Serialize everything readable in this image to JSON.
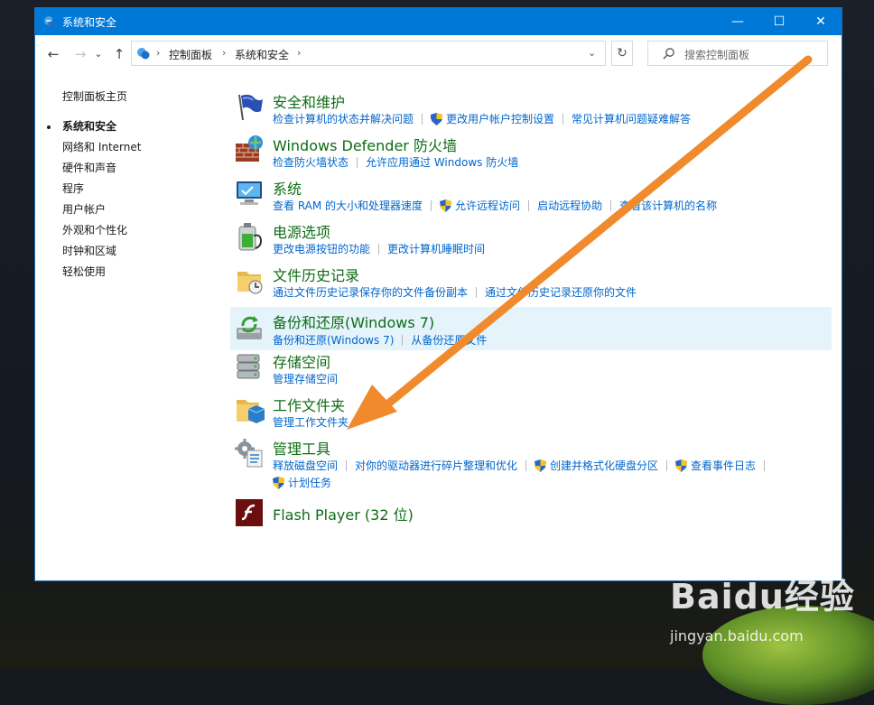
{
  "window": {
    "title": "系统和安全",
    "controls": {
      "minimize": "—",
      "maximize": "☐",
      "close": "✕"
    }
  },
  "nav": {
    "back": "←",
    "forward": "→",
    "recent": "⌄",
    "up": "↑",
    "breadcrumb": [
      "控制面板",
      "系统和安全"
    ],
    "dropdown": "⌄",
    "refresh": "↻",
    "search_placeholder": "搜索控制面板"
  },
  "sidebar": {
    "items": [
      {
        "label": "控制面板主页"
      },
      {
        "label": "系统和安全"
      },
      {
        "label": "网络和 Internet"
      },
      {
        "label": "硬件和声音"
      },
      {
        "label": "程序"
      },
      {
        "label": "用户帐户"
      },
      {
        "label": "外观和个性化"
      },
      {
        "label": "时钟和区域"
      },
      {
        "label": "轻松使用"
      }
    ]
  },
  "categories": [
    {
      "title": "安全和维护",
      "icon": "flag-icon",
      "links": [
        "检查计算机的状态并解决问题",
        "更改用户帐户控制设置",
        "常见计算机问题疑难解答"
      ]
    },
    {
      "title": "Windows Defender 防火墙",
      "icon": "firewall-icon",
      "links": [
        "检查防火墙状态",
        "允许应用通过 Windows 防火墙"
      ]
    },
    {
      "title": "系统",
      "icon": "computer-icon",
      "links": [
        "查看 RAM 的大小和处理器速度",
        "允许远程访问",
        "启动远程协助",
        "查看该计算机的名称"
      ]
    },
    {
      "title": "电源选项",
      "icon": "battery-icon",
      "links": [
        "更改电源按钮的功能",
        "更改计算机睡眠时间"
      ]
    },
    {
      "title": "文件历史记录",
      "icon": "file-history-icon",
      "links": [
        "通过文件历史记录保存你的文件备份副本",
        "通过文件历史记录还原你的文件"
      ]
    },
    {
      "title": "备份和还原(Windows 7)",
      "icon": "backup-icon",
      "links": [
        "备份和还原(Windows 7)",
        "从备份还原文件"
      ]
    },
    {
      "title": "存储空间",
      "icon": "storage-icon",
      "links": [
        "管理存储空间"
      ]
    },
    {
      "title": "工作文件夹",
      "icon": "work-folders-icon",
      "links": [
        "管理工作文件夹"
      ]
    },
    {
      "title": "管理工具",
      "icon": "admin-tools-icon",
      "links": [
        "释放磁盘空间",
        "对你的驱动器进行碎片整理和优化",
        "创建并格式化硬盘分区",
        "查看事件日志",
        "计划任务"
      ]
    },
    {
      "title": "Flash Player (32 位)",
      "icon": "flash-icon",
      "links": []
    }
  ],
  "watermark": {
    "logo": "Baidu经验",
    "url": "jingyan.baidu.com"
  },
  "colors": {
    "titlebar": "#0078d7",
    "category_title": "#0f6c15",
    "link": "#0066cc",
    "highlight": "#e5f3fb",
    "arrow": "#f08a2c"
  }
}
